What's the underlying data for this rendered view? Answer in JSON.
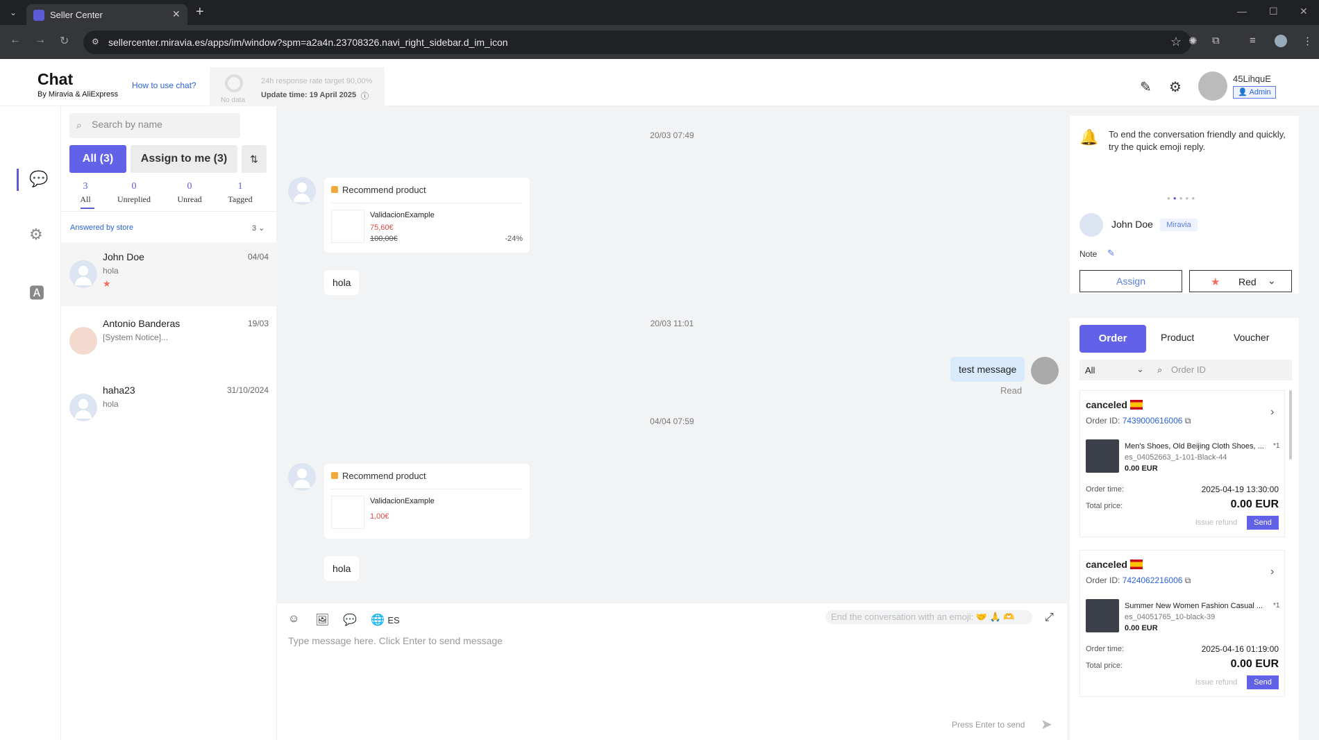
{
  "browser": {
    "tab_title": "Seller Center",
    "url": "sellercenter.miravia.es/apps/im/window?spm=a2a4n.23708326.navi_right_sidebar.d_im_icon"
  },
  "header": {
    "title": "Chat",
    "subtitle": "By Miravia & AliExpress",
    "how_to": "How to use chat?",
    "no_data": "No data",
    "response_target": "24h response rate target 90,00%",
    "update_time": "Update time: 19 April 2025",
    "username": "45LihquE",
    "role": "Admin"
  },
  "list": {
    "search_placeholder": "Search by name",
    "all_btn": "All (3)",
    "assign_btn": "Assign to me (3)",
    "stats": [
      {
        "n": "3",
        "label": "All"
      },
      {
        "n": "0",
        "label": "Unreplied"
      },
      {
        "n": "0",
        "label": "Unread"
      },
      {
        "n": "1",
        "label": "Tagged"
      }
    ],
    "answered_label": "Answered by store",
    "answered_count": "3",
    "conversations": [
      {
        "name": "John Doe",
        "date": "04/04",
        "preview": "hola"
      },
      {
        "name": "Antonio Banderas",
        "date": "19/03",
        "preview": "[System Notice]..."
      },
      {
        "name": "haha23",
        "date": "31/10/2024",
        "preview": "hola"
      }
    ]
  },
  "chat": {
    "messages": [
      {
        "time": "20/03 07:49"
      },
      {
        "card_title": "Recommend product",
        "product": "ValidacionExample",
        "price": "75,60€",
        "orig_price": "100,00€",
        "discount": "-24%"
      },
      {
        "text": "hola"
      },
      {
        "time": "20/03 11:01"
      },
      {
        "text": "test message",
        "status": "Read"
      },
      {
        "time": "04/04 07:59"
      },
      {
        "card_title": "Recommend product",
        "product": "ValidacionExample",
        "price": "1,00€"
      },
      {
        "text": "hola"
      }
    ],
    "lang": "ES",
    "emoji_hint": "End the conversation with an emoji: 🤝 🙏 🫶",
    "input_placeholder": "Type message here. Click Enter to send message",
    "press_enter": "Press Enter to send"
  },
  "right": {
    "tip": "To end the conversation friendly and quickly, try the quick emoji reply.",
    "customer_name": "John Doe",
    "platform": "Miravia",
    "note_label": "Note",
    "assign_btn": "Assign",
    "tag_label": "Red",
    "tabs": [
      "Order",
      "Product",
      "Voucher"
    ],
    "filter_value": "All",
    "order_id_placeholder": "Order ID",
    "orders": [
      {
        "status": "canceled",
        "order_id_label": "Order ID:",
        "order_id": "7439000616006",
        "product": "Men's Shoes, Old Beijing Cloth Shoes, ...",
        "qty": "*1",
        "sku": "es_04052663_1-101-Black-44",
        "price": "0.00 EUR",
        "order_time_label": "Order time:",
        "order_time": "2025-04-19 13:30:00",
        "total_label": "Total price:",
        "total": "0.00 EUR",
        "refund": "Issue refund",
        "send": "Send"
      },
      {
        "status": "canceled",
        "order_id_label": "Order ID:",
        "order_id": "7424062216006",
        "product": "Summer New Women Fashion Casual ...",
        "qty": "*1",
        "sku": "es_04051765_10-black-39",
        "price": "0.00 EUR",
        "order_time_label": "Order time:",
        "order_time": "2025-04-16 01:19:00",
        "total_label": "Total price:",
        "total": "0.00 EUR",
        "refund": "Issue refund",
        "send": "Send"
      }
    ]
  }
}
